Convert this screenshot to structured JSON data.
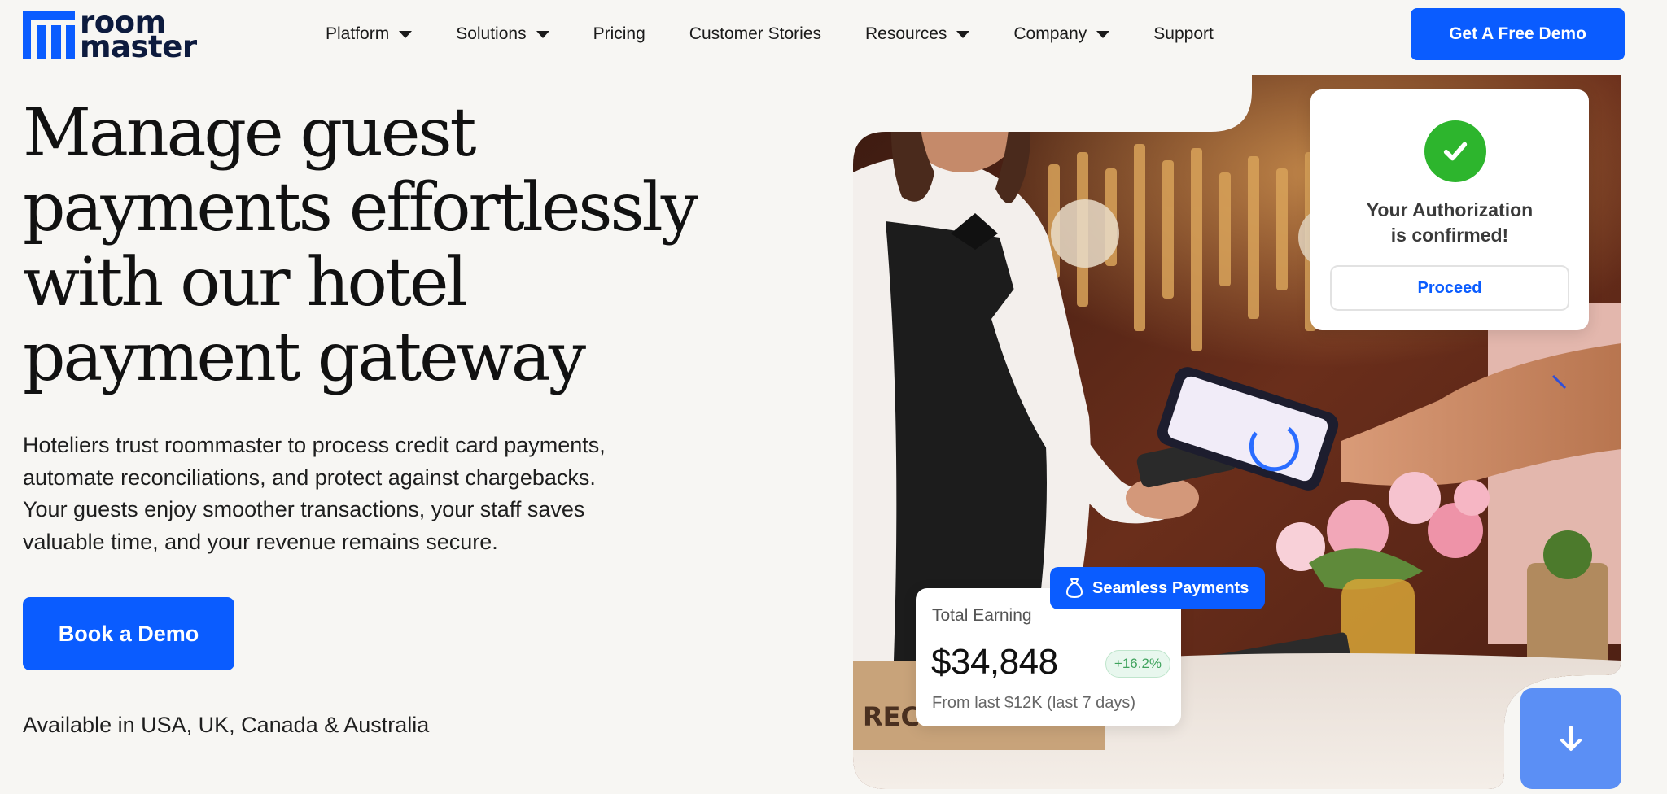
{
  "brand": {
    "logo_line1": "room",
    "logo_line2": "master",
    "color": "#0a5cff"
  },
  "nav": {
    "items": [
      {
        "label": "Platform",
        "has_dropdown": true
      },
      {
        "label": "Solutions",
        "has_dropdown": true
      },
      {
        "label": "Pricing",
        "has_dropdown": false
      },
      {
        "label": "Customer Stories",
        "has_dropdown": false
      },
      {
        "label": "Resources",
        "has_dropdown": true
      },
      {
        "label": "Company",
        "has_dropdown": true
      },
      {
        "label": "Support",
        "has_dropdown": false
      }
    ],
    "cta_label": "Get A Free Demo"
  },
  "hero": {
    "title": "Manage guest payments effortlessly with our hotel payment gateway",
    "description": "Hoteliers trust roommaster to process credit card payments, automate reconciliations, and protect against chargebacks. Your guests enjoy smoother transactions, your staff saves valuable time, and your revenue remains secure.",
    "cta_label": "Book a Demo",
    "availability": "Available in USA, UK, Canada & Australia"
  },
  "auth_card": {
    "line1": "Your Authorization",
    "line2": "is confirmed!",
    "button_label": "Proceed",
    "icon": "check-icon",
    "status_color": "#2db52d"
  },
  "earning_card": {
    "label": "Total Earning",
    "value": "$34,848",
    "change": "+16.2%",
    "subtext": "From last $12K (last 7 days)"
  },
  "badge": {
    "label": "Seamless Payments",
    "icon": "money-bag-icon"
  },
  "scroll_button": {
    "icon": "arrow-down-icon"
  }
}
